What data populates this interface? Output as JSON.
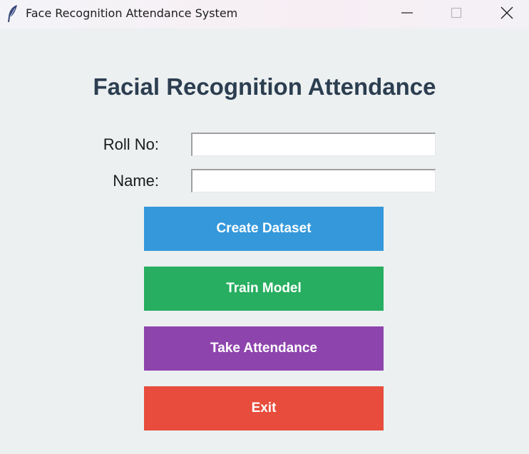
{
  "window": {
    "title": "Face Recognition Attendance System",
    "icon": "feather-icon"
  },
  "main": {
    "heading": "Facial Recognition Attendance",
    "roll_label": "Roll No:",
    "roll_value": "",
    "name_label": "Name:",
    "name_value": ""
  },
  "buttons": {
    "create_dataset": "Create Dataset",
    "train_model": "Train Model",
    "take_attendance": "Take Attendance",
    "exit": "Exit"
  },
  "colors": {
    "background": "#ecf0f1",
    "heading": "#2c3e50",
    "create_dataset": "#3498db",
    "train_model": "#27ae60",
    "take_attendance": "#8e44ad",
    "exit": "#e74c3c"
  }
}
